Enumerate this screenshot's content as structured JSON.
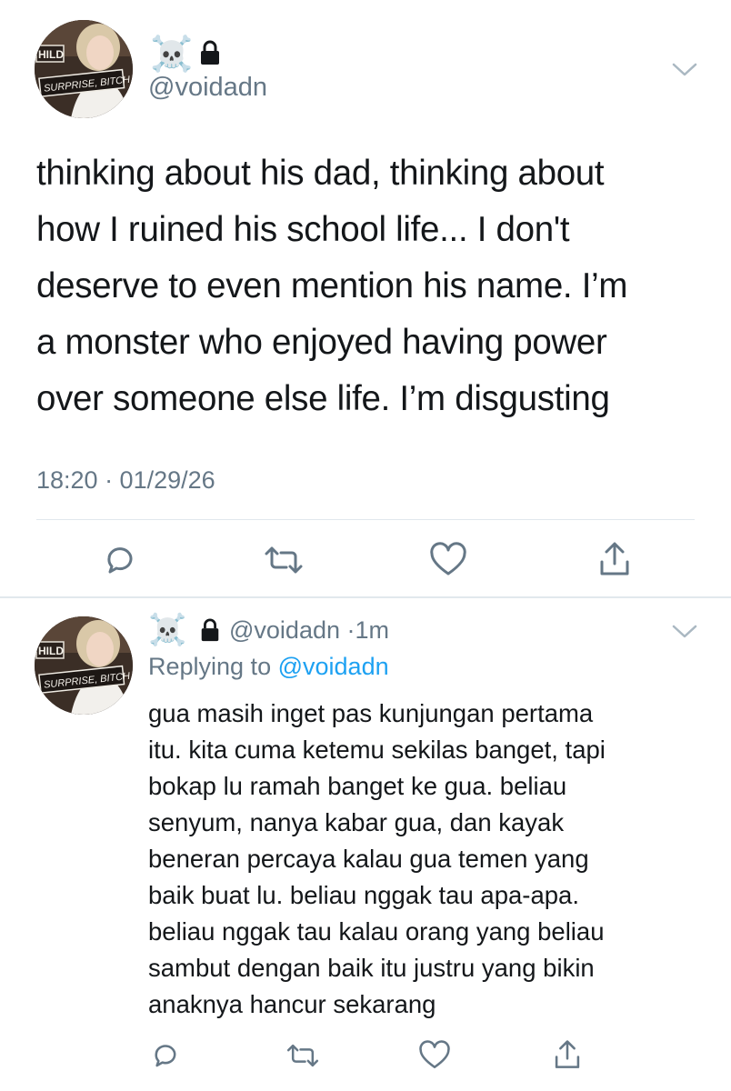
{
  "colors": {
    "text": "#14171a",
    "secondary": "#657786",
    "accent": "#1da1f2",
    "divider": "#e1e8ed",
    "icon": "#657786"
  },
  "main_tweet": {
    "avatar_sign_top": "HILD",
    "avatar_sign": "SURPRISE, BITCH",
    "name_emoji": "☠️",
    "lock_icon": "lock-icon",
    "handle": "@voidadn",
    "text_lines": [
      "thinking about his dad, thinking about",
      "how I ruined his school life... I don't",
      "deserve to even mention his name. I’m",
      "a monster who enjoyed having power",
      "over someone else life. I’m disgusting"
    ],
    "timestamp": "18:20 · 01/29/26",
    "actions": [
      "reply-icon",
      "retweet-icon",
      "like-icon",
      "share-icon"
    ]
  },
  "reply_tweet": {
    "avatar_sign_top": "HILD",
    "avatar_sign": "SURPRISE, BITCH",
    "name_emoji": "☠️",
    "handle": "@voidadn",
    "separator": "·",
    "time": "1m",
    "replying_prefix": "Replying to",
    "replying_handle": "@voidadn",
    "text_lines": [
      "gua masih inget pas kunjungan pertama",
      "itu. kita cuma ketemu sekilas banget, tapi",
      "bokap lu ramah banget ke gua. beliau",
      "senyum, nanya kabar gua, dan kayak",
      "beneran percaya kalau gua temen yang",
      "baik buat lu. beliau nggak tau apa-apa.",
      "beliau nggak tau kalau orang yang beliau",
      "sambut dengan baik itu justru yang bikin",
      "anaknya hancur sekarang"
    ],
    "actions": [
      "reply-icon",
      "retweet-icon",
      "like-icon",
      "share-icon"
    ]
  }
}
